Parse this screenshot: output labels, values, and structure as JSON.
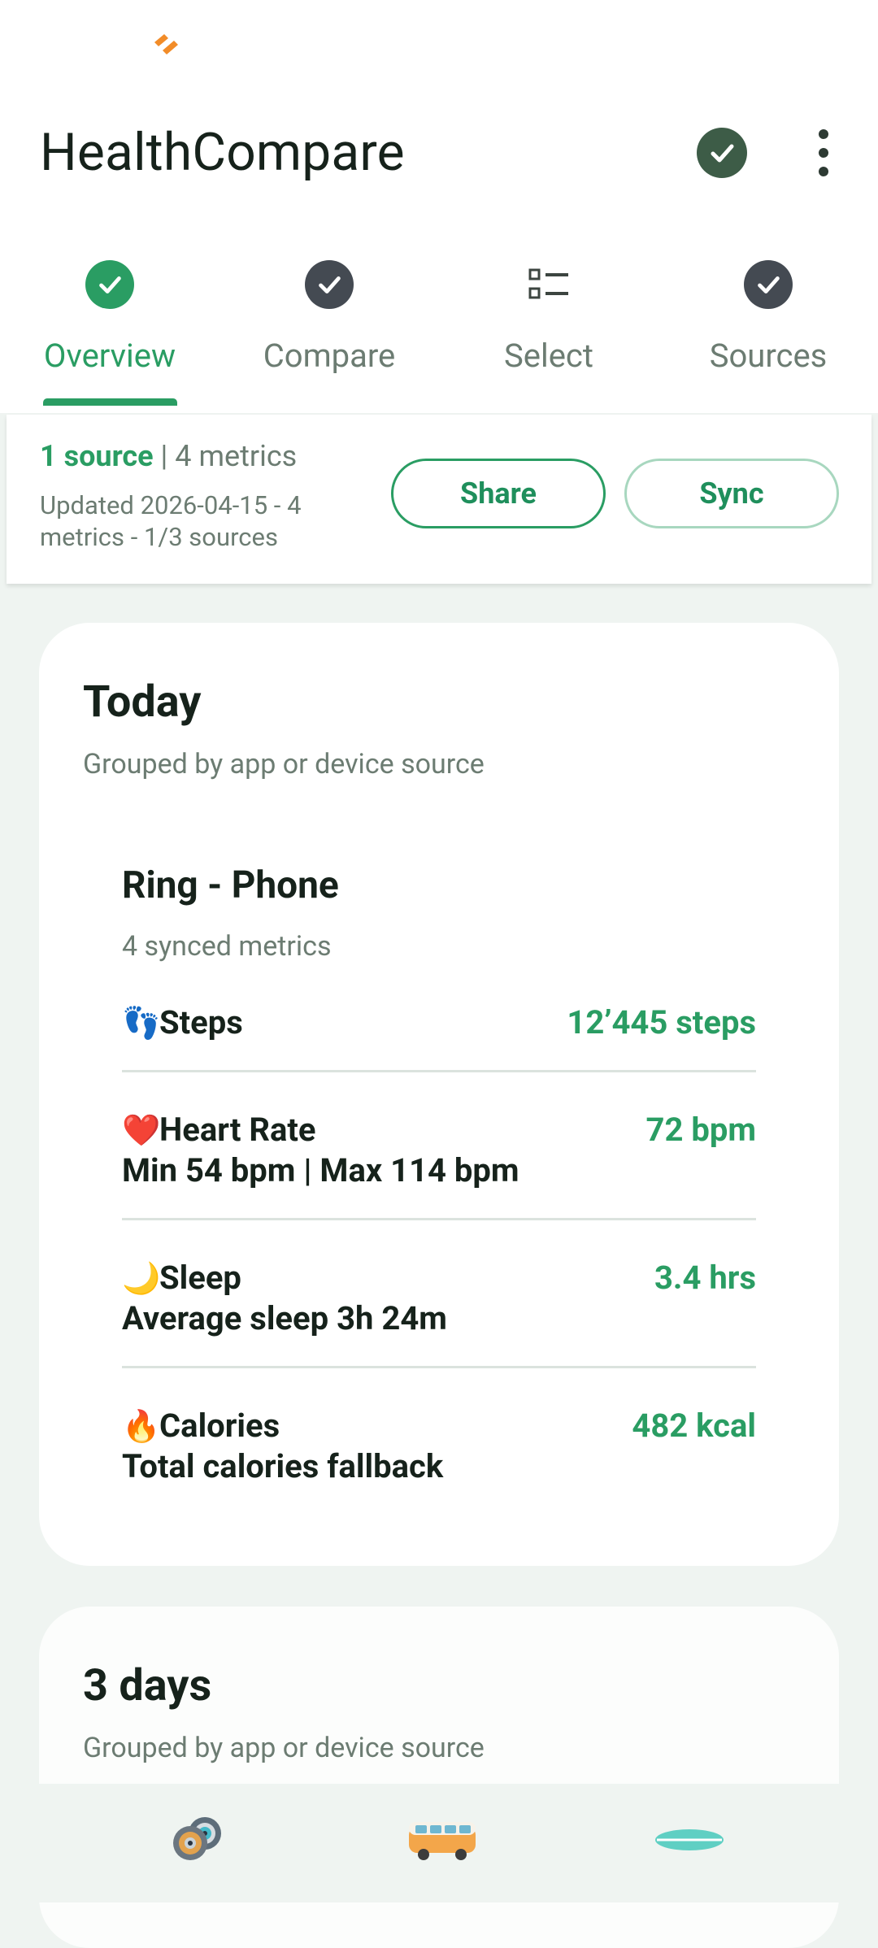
{
  "app": {
    "title": "HealthCompare"
  },
  "tabs": [
    {
      "label": "Overview",
      "icon": "check-circle-icon",
      "active": true
    },
    {
      "label": "Compare",
      "icon": "check-circle-icon",
      "active": false
    },
    {
      "label": "Select",
      "icon": "list-icon",
      "active": false
    },
    {
      "label": "Sources",
      "icon": "check-circle-icon",
      "active": false
    }
  ],
  "summary": {
    "sources": "1 source",
    "separator": " | ",
    "metrics": "4 metrics",
    "updated": "Updated 2026-04-15 - 4 metrics - 1/3 sources",
    "share_label": "Share",
    "sync_label": "Sync"
  },
  "today": {
    "title": "Today",
    "subtitle": "Grouped by app or device source",
    "source": {
      "name": "Ring - Phone",
      "count": "4 synced metrics",
      "metrics": [
        {
          "emoji": "👣",
          "name": "Steps",
          "value": "12’445 steps",
          "detail": ""
        },
        {
          "emoji": "❤️",
          "name": "Heart Rate",
          "value": "72 bpm",
          "detail": "Min 54 bpm | Max 114 bpm"
        },
        {
          "emoji": "🌙",
          "name": "Sleep",
          "value": "3.4 hrs",
          "detail": "Average sleep 3h 24m"
        },
        {
          "emoji": "🔥",
          "name": "Calories",
          "value": "482 kcal",
          "detail": "Total calories fallback"
        }
      ]
    }
  },
  "three_days": {
    "title": "3 days",
    "subtitle": "Grouped by app or device source"
  },
  "bottom_nav": [
    {
      "icon": "speakers-icon"
    },
    {
      "icon": "camper-van-icon"
    },
    {
      "icon": "surfboard-icon"
    }
  ],
  "colors": {
    "accent": "#2a9d63",
    "dark_check": "#3d5c47",
    "tab_check": "#444a52",
    "muted_text": "#6c7c72",
    "background": "#eff4f1"
  }
}
